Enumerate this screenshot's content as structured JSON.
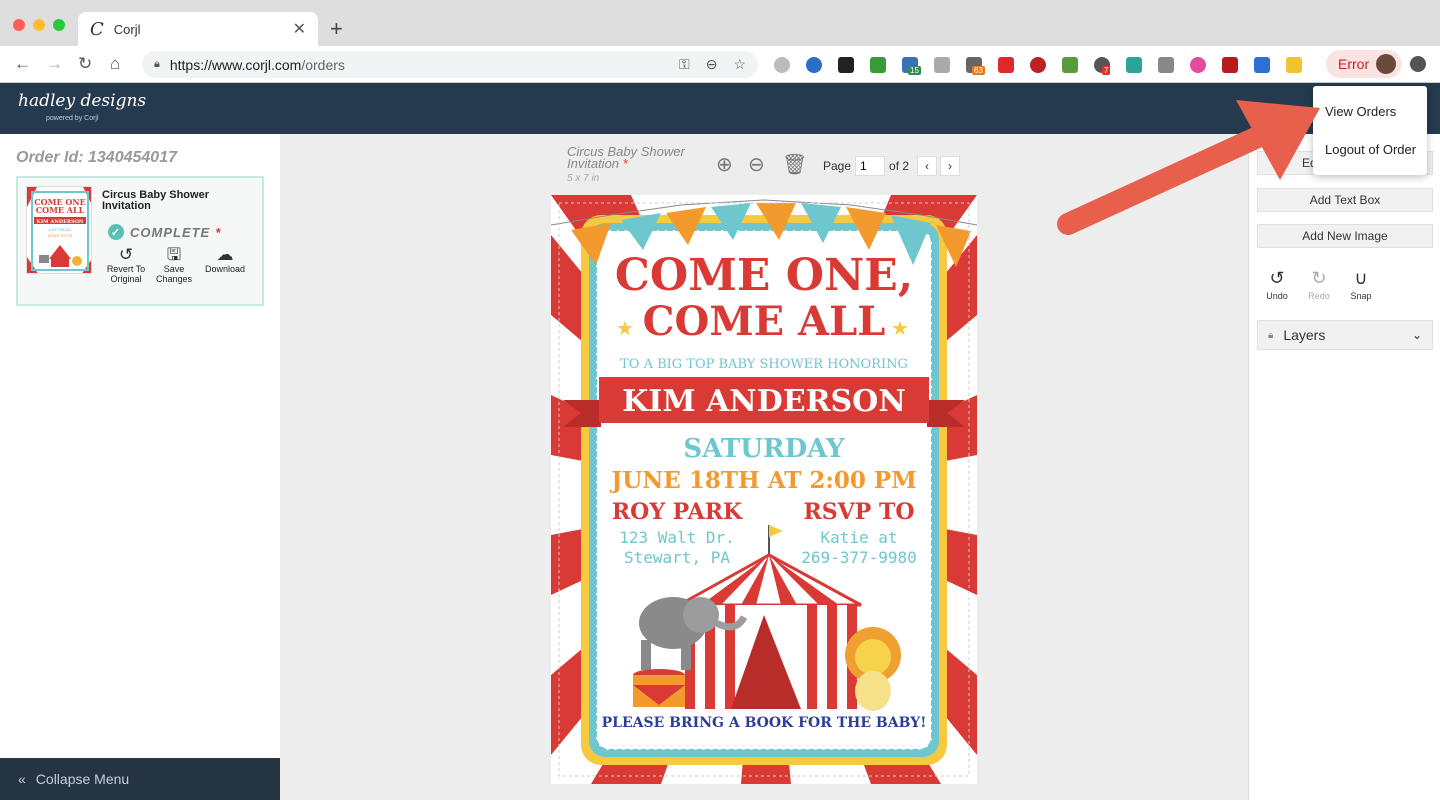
{
  "browser": {
    "tab_title": "Corjl",
    "tab_logo": "C",
    "url_host": "https://www.corjl.com",
    "url_path": "/orders",
    "error_label": "Error",
    "extension_badges": [
      "15",
      "63",
      "7"
    ]
  },
  "app": {
    "brand": "hadley designs",
    "brand_sub": "powered by Corjl"
  },
  "order": {
    "id_label": "Order Id: 1340454017",
    "title": "Circus Baby Shower Invitation",
    "status": "COMPLETE",
    "status_star": "*",
    "actions": {
      "revert": "Revert To Original",
      "save": "Save Changes",
      "download": "Download"
    }
  },
  "sidebar": {
    "collapse_label": "Collapse Menu"
  },
  "canvas": {
    "doc_title": "Circus Baby Shower Invitation",
    "doc_star": "*",
    "doc_size": "5 x 7 in",
    "page_label": "Page",
    "page_value": "1",
    "page_of": "of 2"
  },
  "invitation": {
    "line1": "COME ONE,",
    "line2": "COME ALL",
    "subtitle": "TO A BIG TOP BABY SHOWER HONORING",
    "name": "KIM ANDERSON",
    "day": "SATURDAY",
    "date": "JUNE 18TH AT 2:00 PM",
    "venue_title": "ROY PARK",
    "venue_line1": "123 Walt Dr.",
    "venue_line2": "Stewart, PA",
    "rsvp_title": "RSVP TO",
    "rsvp_line1": "Katie at",
    "rsvp_line2": "269-377-9980",
    "footer": "PLEASE BRING A BOOK FOR THE BABY!"
  },
  "right_panel": {
    "edit_partial": "Ed",
    "add_text": "Add Text Box",
    "add_image": "Add New Image",
    "undo": "Undo",
    "redo": "Redo",
    "snap": "Snap",
    "layers": "Layers"
  },
  "dropdown": {
    "view_orders": "View Orders",
    "logout": "Logout of Order"
  },
  "colors": {
    "app_bar": "#263a4f",
    "annotation_arrow": "#e8604c",
    "complete_check": "#5bc0b4",
    "circus_red": "#d93a35",
    "circus_teal": "#6ec6cf",
    "circus_orange": "#f39a2f"
  }
}
